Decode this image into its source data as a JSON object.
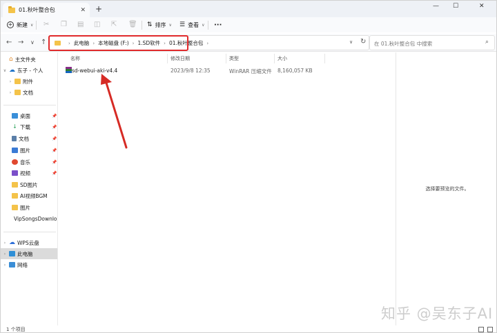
{
  "tab": {
    "title": "01.秋叶整合包",
    "close_glyph": "✕",
    "new_glyph": "+"
  },
  "window_controls": {
    "minimize": "—",
    "maximize": "☐",
    "close": "✕"
  },
  "toolbar": {
    "new_label": "新建",
    "sort_label": "排序",
    "view_label": "查看",
    "more_glyph": "···"
  },
  "breadcrumb": [
    "此电脑",
    "本地磁盘 (F:)",
    "1.SD软件",
    "01.秋叶整合包"
  ],
  "search": {
    "placeholder": "在 01.秋叶整合包 中搜索"
  },
  "sidebar": {
    "home": "主文件夹",
    "cloud_user": "东子 - 个人",
    "cloud_children": [
      "附件",
      "文档"
    ],
    "quick_access": [
      {
        "label": "桌面",
        "icon": "desktop-icon",
        "color": "#3a8fd9",
        "pinned": true
      },
      {
        "label": "下载",
        "icon": "download-icon",
        "color": "#2aa05a",
        "pinned": true
      },
      {
        "label": "文档",
        "icon": "document-icon",
        "color": "#5b7fa8",
        "pinned": true
      },
      {
        "label": "图片",
        "icon": "picture-icon",
        "color": "#3a7bd5",
        "pinned": true
      },
      {
        "label": "音乐",
        "icon": "music-icon",
        "color": "#e0482f",
        "pinned": true
      },
      {
        "label": "视频",
        "icon": "video-icon",
        "color": "#7b4fc9",
        "pinned": true
      },
      {
        "label": "SD图片",
        "icon": "folder-icon",
        "color": "#f4c34a",
        "pinned": false
      },
      {
        "label": "AI视频BGM",
        "icon": "folder-icon",
        "color": "#f4c34a",
        "pinned": false
      },
      {
        "label": "图片",
        "icon": "folder-icon",
        "color": "#f4c34a",
        "pinned": false
      },
      {
        "label": "VipSongsDownload",
        "icon": "folder-icon",
        "color": "#f4c34a",
        "pinned": false
      }
    ],
    "drives": [
      "WPS云盘",
      "此电脑",
      "网络"
    ],
    "pin_glyph": "📌"
  },
  "columns": {
    "name": "名称",
    "modified": "修改日期",
    "type": "类型",
    "size": "大小"
  },
  "files": [
    {
      "name": "sd-webui-aki-v4.4",
      "modified": "2023/9/8 12:35",
      "type": "WinRAR 压缩文件",
      "size": "8,160,057 KB"
    }
  ],
  "preview": {
    "message": "选择要预览的文件。"
  },
  "status": {
    "count": "1 个项目"
  },
  "watermark": "知乎 @吴东子AI",
  "colors": {
    "highlight_red": "#e0282a",
    "folder_yellow": "#f4c34a",
    "selection_gray": "#dbdbdb"
  }
}
